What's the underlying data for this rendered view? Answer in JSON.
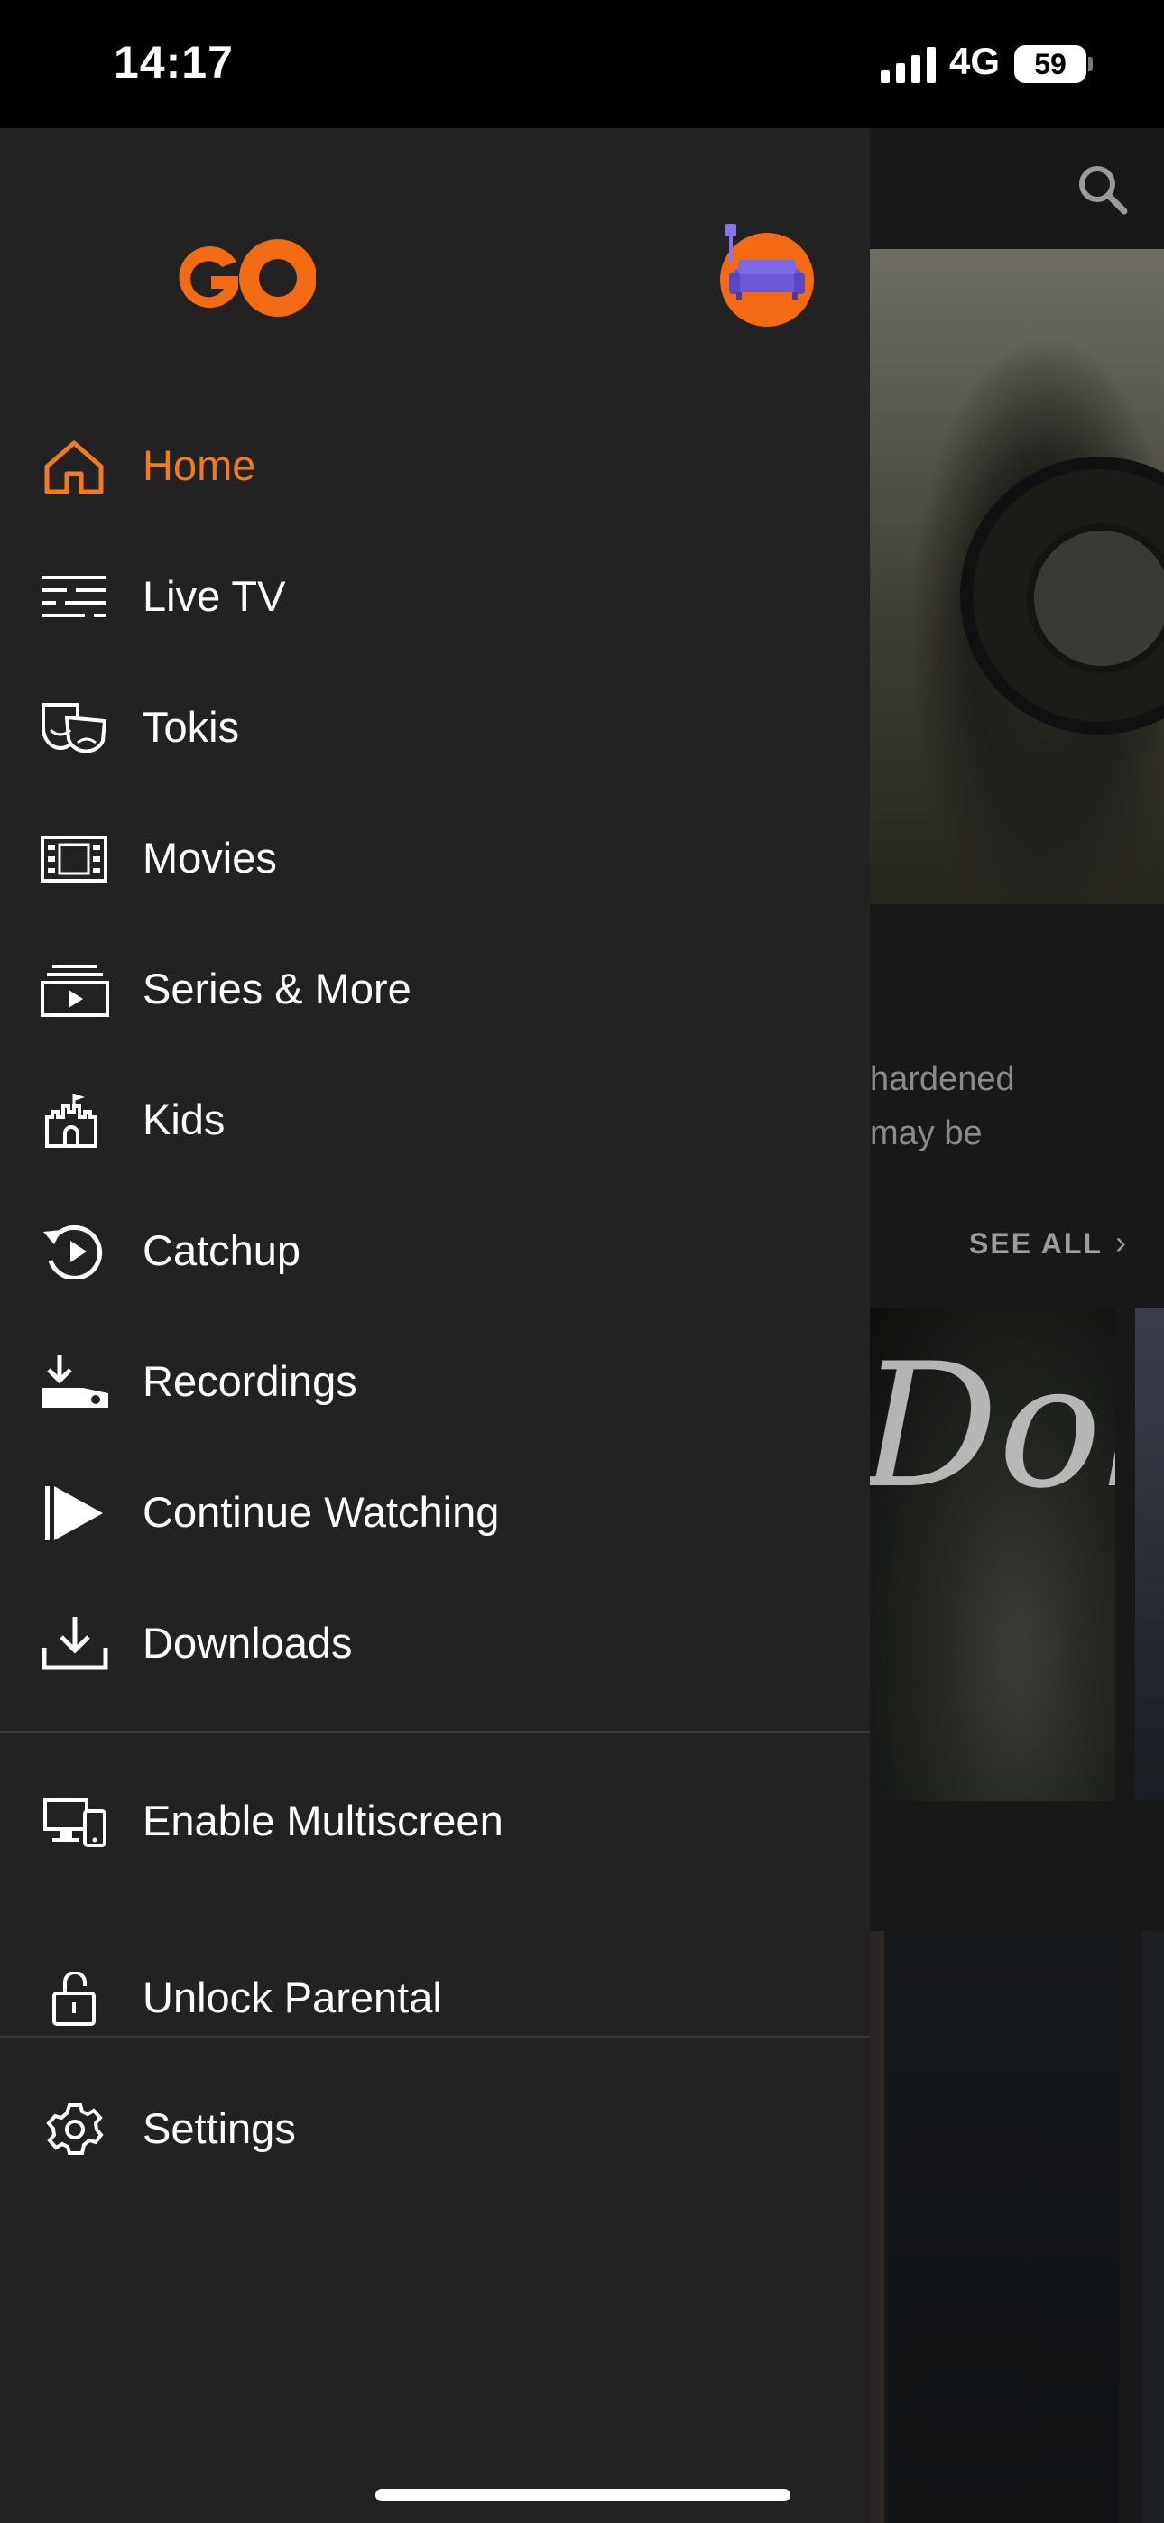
{
  "status": {
    "time": "14:17",
    "network": "4G",
    "battery": "59"
  },
  "background": {
    "description_line1": "hardened",
    "description_line2": "may be",
    "see_all": "SEE ALL",
    "poster_script": "Dolf"
  },
  "drawer": {
    "logo_text": "GO",
    "accent_color": "#f47a1f",
    "items": [
      {
        "label": "Home",
        "icon": "home-icon",
        "active": true
      },
      {
        "label": "Live TV",
        "icon": "live-tv-icon"
      },
      {
        "label": "Tokis",
        "icon": "theater-masks-icon"
      },
      {
        "label": "Movies",
        "icon": "film-icon"
      },
      {
        "label": "Series & More",
        "icon": "series-stack-icon"
      },
      {
        "label": "Kids",
        "icon": "castle-icon"
      },
      {
        "label": "Catchup",
        "icon": "replay-icon"
      },
      {
        "label": "Recordings",
        "icon": "recordings-icon"
      },
      {
        "label": "Continue Watching",
        "icon": "play-icon"
      },
      {
        "label": "Downloads",
        "icon": "download-icon"
      },
      {
        "label": "Enable Multiscreen",
        "icon": "multiscreen-icon"
      },
      {
        "label": "Unlock Parental",
        "icon": "unlock-icon"
      },
      {
        "label": "Settings",
        "icon": "gear-icon"
      }
    ]
  }
}
